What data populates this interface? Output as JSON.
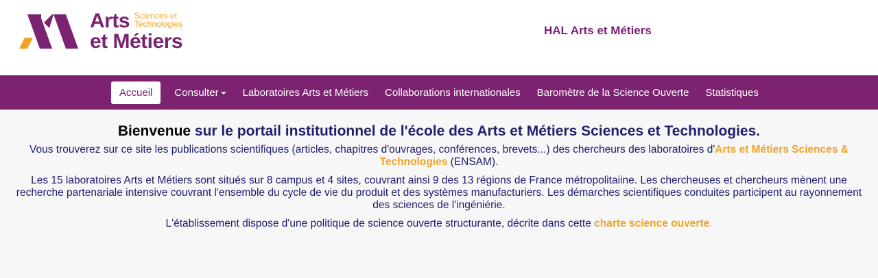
{
  "logo": {
    "arts": "Arts",
    "sub_line1": "Sciences et",
    "sub_line2": "Technologies",
    "metiers": "et Métiers"
  },
  "site_title": "HAL Arts et Métiers",
  "nav": {
    "items": [
      {
        "label": "Accueil",
        "active": true
      },
      {
        "label": "Consulter",
        "dropdown": true
      },
      {
        "label": "Laboratoires Arts et Métiers"
      },
      {
        "label": "Collaborations internationales"
      },
      {
        "label": "Baromètre de la Science Ouverte"
      },
      {
        "label": "Statistiques"
      }
    ]
  },
  "content": {
    "welcome_strong": "Bienvenue",
    "welcome_rest": " sur le portail institutionnel de l'école des Arts et Métiers Sciences et Technologies.",
    "p1_before": "Vous trouverez sur ce site les publications scientifiques (articles, chapitres d'ouvrages, conférences, brevets...) des chercheurs des laboratoires d'",
    "p1_link": "Arts et Métiers Sciences & Technologies",
    "p1_after": " (ENSAM).",
    "p2": "Les 15 laboratoires Arts et Métiers sont situés sur 8 campus et 4 sites, couvrant ainsi 9 des 13 régions de France métropolitaiine. Les chercheuses et chercheurs mènent une recherche partenariale intensive couvrant l'ensemble du cycle de vie du produit et des systèmes manufacturiers. Les démarches scientifiques conduites participent au rayonnement des sciences de l'ingéniérie.",
    "p3_before": "L'établissement dispose d'une politique de science ouverte structurante, décrite dans cette ",
    "p3_link": "charte science ouverte",
    "p3_after": "."
  },
  "colors": {
    "brand_purple": "#7c2270",
    "accent_orange": "#f3a21f",
    "text_navy": "#1a1a6e"
  }
}
